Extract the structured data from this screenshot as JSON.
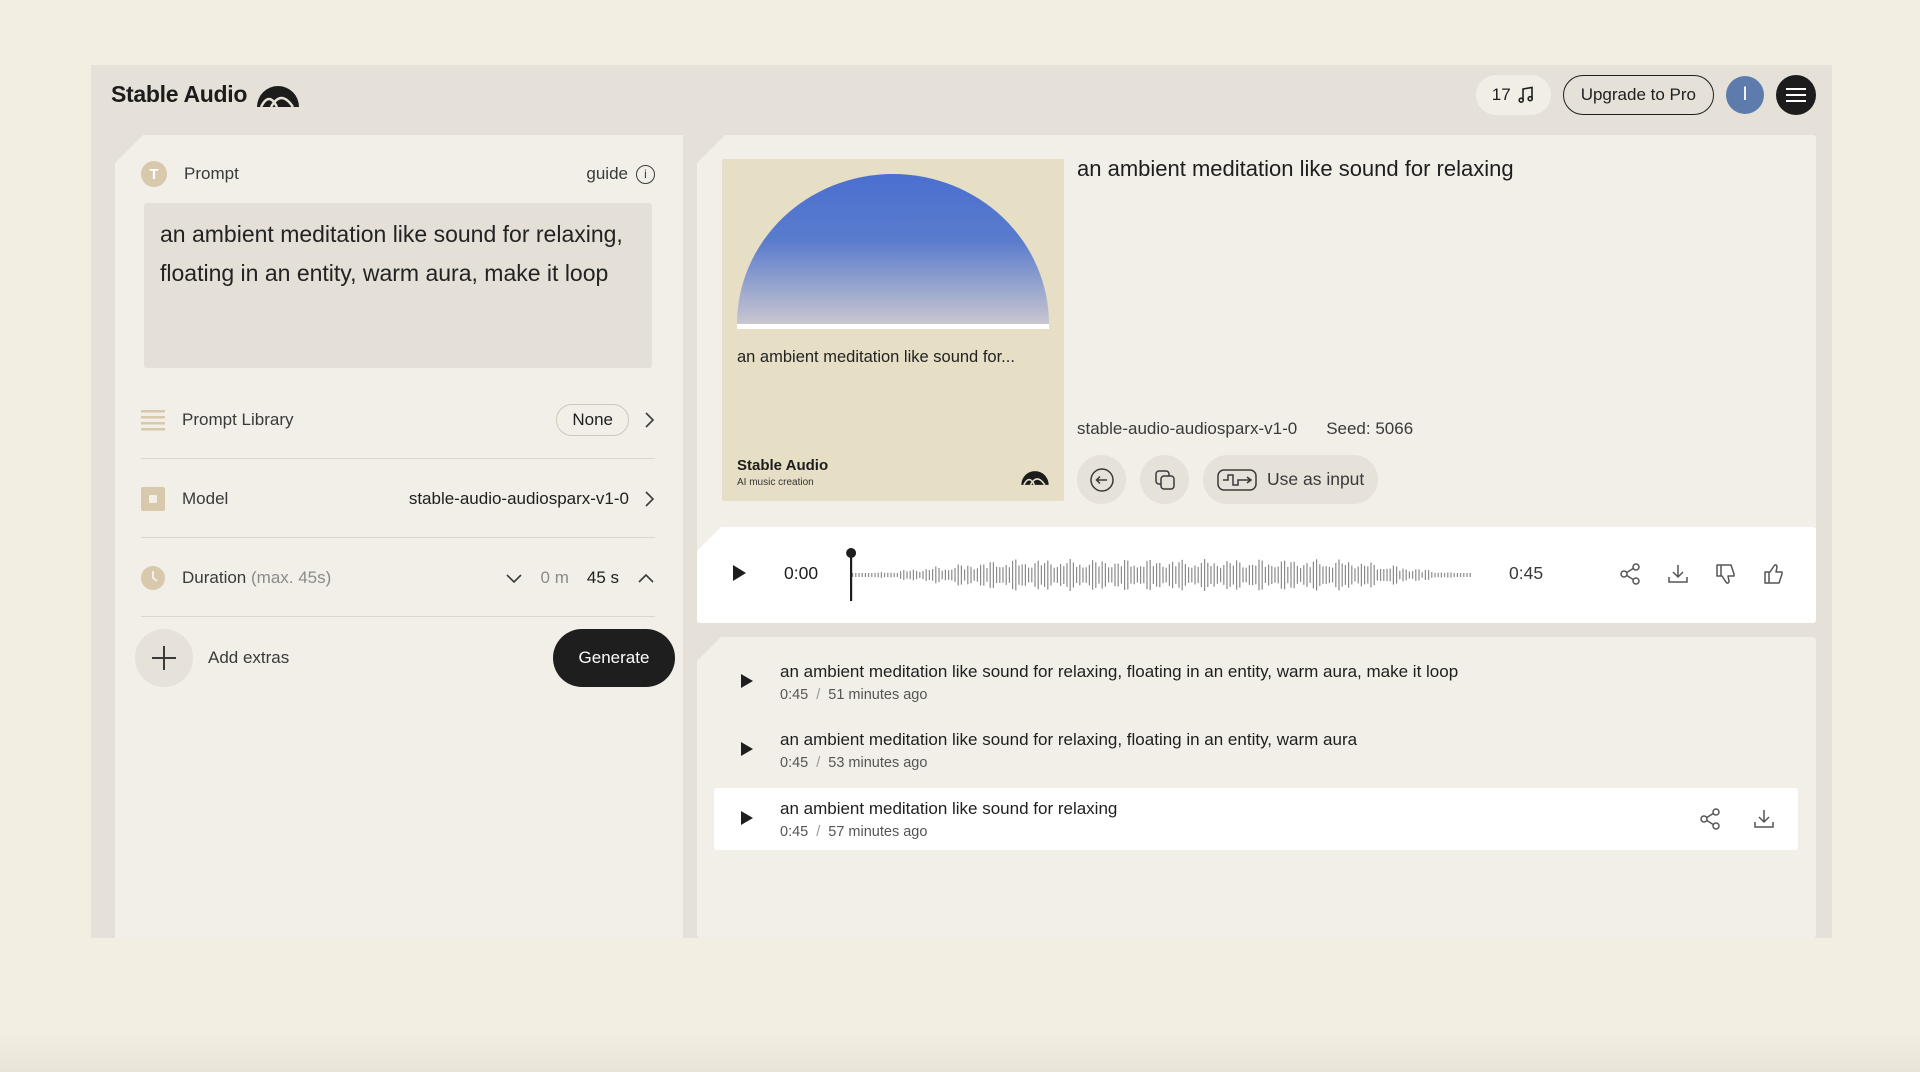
{
  "app": {
    "name": "Stable Audio"
  },
  "header": {
    "credits": "17",
    "upgrade_label": "Upgrade to Pro",
    "avatar_initial": "I"
  },
  "left": {
    "prompt_label": "Prompt",
    "guide_label": "guide",
    "prompt_text": "an ambient meditation like sound for relaxing, floating in an entity, warm aura, make it loop",
    "prompt_library_label": "Prompt Library",
    "prompt_library_value": "None",
    "model_label": "Model",
    "model_value": "stable-audio-audiosparx-v1-0",
    "duration_label": "Duration",
    "duration_hint": "(max. 45s)",
    "duration_minutes": "0 m",
    "duration_seconds": "45 s",
    "extras_label": "Add extras",
    "generate_label": "Generate"
  },
  "result": {
    "title": "an ambient meditation like sound for relaxing",
    "cover_title": "an ambient meditation like sound for...",
    "cover_brand": "Stable Audio",
    "cover_sub": "AI music creation",
    "model": "stable-audio-audiosparx-v1-0",
    "seed": "Seed: 5066",
    "use_as_input_label": "Use as input",
    "player": {
      "current_time": "0:00",
      "duration": "0:45",
      "progress": 0
    }
  },
  "history": [
    {
      "title": "an ambient meditation like sound for relaxing, floating in an entity, warm aura, make it loop",
      "length": "0:45",
      "ago": "51 minutes ago",
      "separator": "/"
    },
    {
      "title": "an ambient meditation like sound for relaxing, floating in an entity, warm aura",
      "length": "0:45",
      "ago": "53 minutes ago",
      "separator": "/"
    },
    {
      "title": "an ambient meditation like sound for relaxing",
      "length": "0:45",
      "ago": "57 minutes ago",
      "separator": "/"
    }
  ],
  "colors": {
    "accent_dark": "#1e1e1e",
    "panel": "#f1efe8",
    "frame": "#e5e1d8",
    "cover_blue": "#4f72cc"
  }
}
